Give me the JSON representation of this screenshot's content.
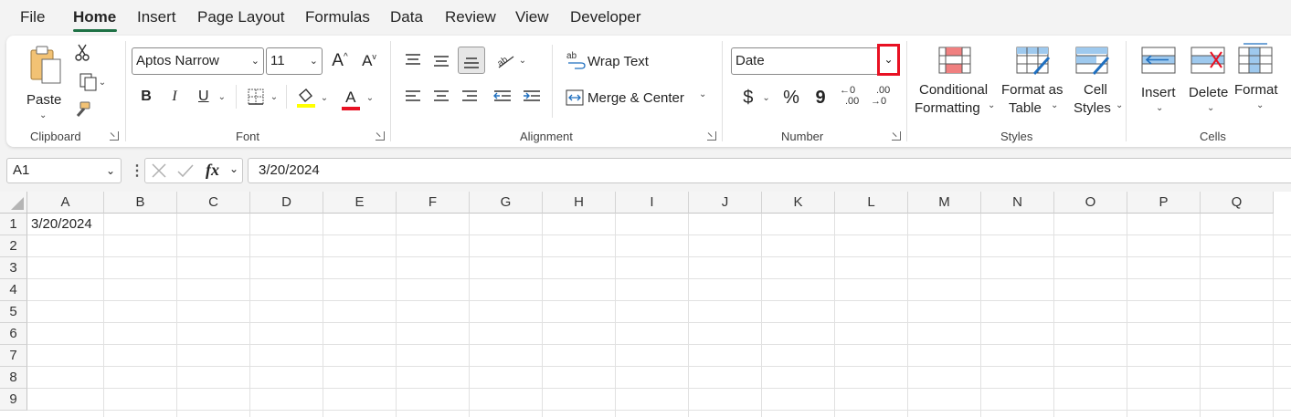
{
  "menu": {
    "tabs": [
      "File",
      "Home",
      "Insert",
      "Page Layout",
      "Formulas",
      "Data",
      "Review",
      "View",
      "Developer"
    ],
    "active": "Home"
  },
  "clipboard": {
    "paste_label": "Paste",
    "group_label": "Clipboard"
  },
  "font": {
    "name_value": "Aptos Narrow",
    "size_value": "11",
    "group_label": "Font",
    "bold": "B",
    "italic": "I",
    "underline": "U",
    "font_color_glyph": "A",
    "grow_glyph": "A",
    "shrink_glyph": "A",
    "highlight_color": "#ffff00",
    "font_color": "#e81123"
  },
  "alignment": {
    "wrap_text_label": "Wrap Text",
    "merge_center_label": "Merge & Center",
    "group_label": "Alignment",
    "wrap_icon_text": "ab"
  },
  "number": {
    "format_value": "Date",
    "group_label": "Number",
    "currency_glyph": "$",
    "percent_glyph": "%",
    "comma_glyph": "9",
    "increase_decimal_top": "←0",
    "increase_decimal_bottom": ".00",
    "decrease_decimal_top": ".00",
    "decrease_decimal_bottom": "→0",
    "highlight_color": "#e81123"
  },
  "styles": {
    "conditional_line1": "Conditional",
    "conditional_line2": "Formatting",
    "format_table_line1": "Format as",
    "format_table_line2": "Table",
    "cell_styles_line1": "Cell",
    "cell_styles_line2": "Styles",
    "group_label": "Styles"
  },
  "cells": {
    "insert_label": "Insert",
    "delete_label": "Delete",
    "format_label": "Format",
    "group_label": "Cells"
  },
  "formula_bar": {
    "name_box": "A1",
    "fx_glyph": "fx",
    "formula": "3/20/2024"
  },
  "sheet": {
    "columns": [
      "A",
      "B",
      "C",
      "D",
      "E",
      "F",
      "G",
      "H",
      "I",
      "J",
      "K",
      "L",
      "M",
      "N",
      "O",
      "P",
      "Q"
    ],
    "rows": [
      "1",
      "2",
      "3",
      "4",
      "5",
      "6",
      "7",
      "8",
      "9"
    ],
    "a1_value": "3/20/2024"
  },
  "colors": {
    "accent": "#1e7145",
    "highlight_box": "#e81123"
  }
}
